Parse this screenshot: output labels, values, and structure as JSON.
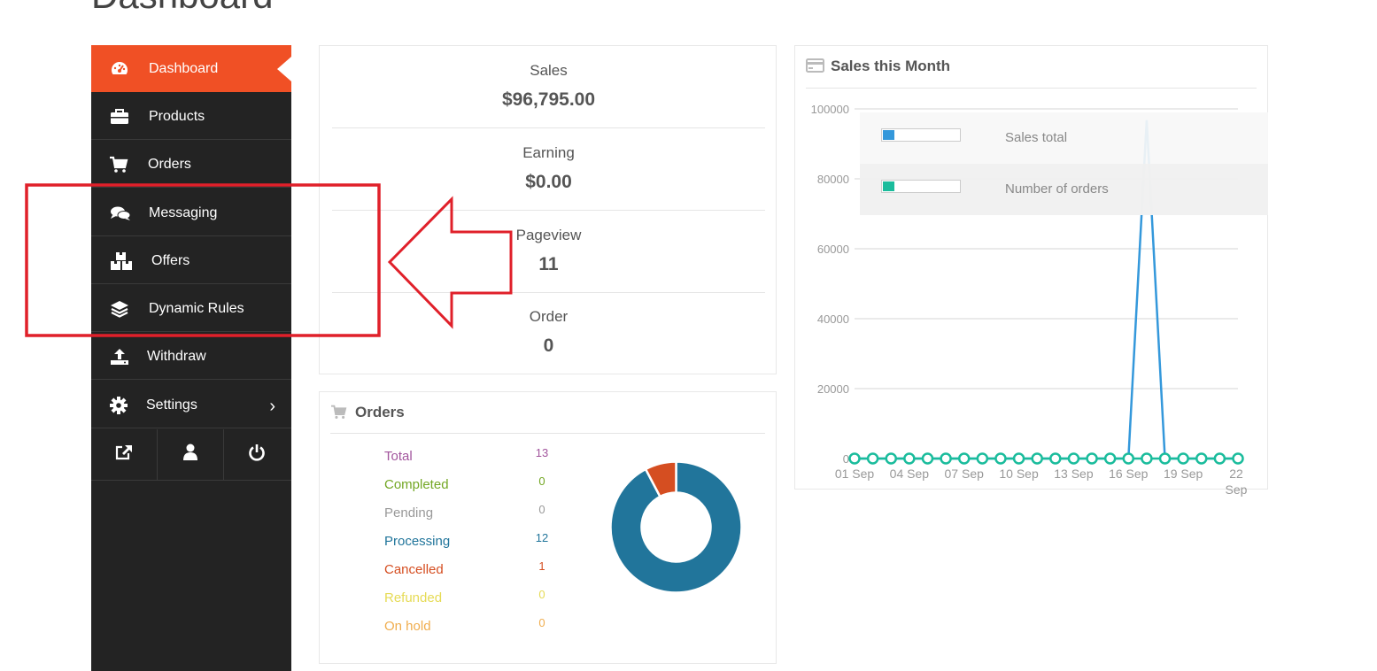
{
  "page": {
    "title": "Dashboard"
  },
  "sidebar": {
    "items": [
      {
        "label": "Dashboard",
        "icon": "dashboard-gauge-icon",
        "active": true
      },
      {
        "label": "Products",
        "icon": "briefcase-icon"
      },
      {
        "label": "Orders",
        "icon": "cart-icon"
      },
      {
        "label": "Messaging",
        "icon": "chat-bubbles-icon"
      },
      {
        "label": "Offers",
        "icon": "boxes-icon"
      },
      {
        "label": "Dynamic Rules",
        "icon": "layers-icon"
      },
      {
        "label": "Withdraw",
        "icon": "upload-icon"
      },
      {
        "label": "Settings",
        "icon": "gear-icon"
      }
    ],
    "footer": [
      "external-link-icon",
      "user-icon",
      "power-icon"
    ],
    "accent": "#f05025",
    "background": "#232323"
  },
  "stats": [
    {
      "label": "Sales",
      "value": "$96,795.00"
    },
    {
      "label": "Earning",
      "value": "$0.00"
    },
    {
      "label": "Pageview",
      "value": "11"
    },
    {
      "label": "Order",
      "value": "0"
    }
  ],
  "orders_panel": {
    "title": "Orders",
    "rows": [
      {
        "label": "Total",
        "value": "13",
        "color": "#a2559d"
      },
      {
        "label": "Completed",
        "value": "0",
        "color": "#73a724"
      },
      {
        "label": "Pending",
        "value": "0",
        "color": "#999999"
      },
      {
        "label": "Processing",
        "value": "12",
        "color": "#21759b"
      },
      {
        "label": "Cancelled",
        "value": "1",
        "color": "#d54e21"
      },
      {
        "label": "Refunded",
        "value": "0",
        "color": "#e6db55"
      },
      {
        "label": "On hold",
        "value": "0",
        "color": "#f0ad4e"
      }
    ],
    "donut": [
      {
        "label": "Processing",
        "value": 12,
        "color": "#21759b"
      },
      {
        "label": "Cancelled",
        "value": 1,
        "color": "#d54e21"
      }
    ]
  },
  "sales_month": {
    "title": "Sales this Month",
    "legend": [
      {
        "label": "Sales total",
        "color": "#3498db"
      },
      {
        "label": "Number of orders",
        "color": "#1abc9c"
      }
    ]
  },
  "chart_data": {
    "type": "line",
    "title": "Sales this Month",
    "ylim": [
      0,
      100000
    ],
    "yticks": [
      0,
      20000,
      40000,
      60000,
      80000,
      100000
    ],
    "xtick_labels": [
      "01 Sep",
      "04 Sep",
      "07 Sep",
      "10 Sep",
      "13 Sep",
      "16 Sep",
      "19 Sep",
      "22 Sep"
    ],
    "x": [
      "01 Sep",
      "02 Sep",
      "03 Sep",
      "04 Sep",
      "05 Sep",
      "06 Sep",
      "07 Sep",
      "08 Sep",
      "09 Sep",
      "10 Sep",
      "11 Sep",
      "12 Sep",
      "13 Sep",
      "14 Sep",
      "15 Sep",
      "16 Sep",
      "17 Sep",
      "18 Sep",
      "19 Sep",
      "20 Sep",
      "21 Sep",
      "22 Sep"
    ],
    "series": [
      {
        "name": "Sales total",
        "color": "#3498db",
        "values": [
          0,
          0,
          0,
          0,
          0,
          0,
          0,
          0,
          0,
          0,
          0,
          0,
          0,
          0,
          0,
          0,
          96795,
          0,
          0,
          0,
          0,
          0
        ]
      },
      {
        "name": "Number of orders",
        "color": "#1abc9c",
        "values": [
          0,
          0,
          0,
          0,
          0,
          0,
          0,
          0,
          0,
          0,
          0,
          0,
          0,
          0,
          0,
          0,
          0,
          0,
          0,
          0,
          0,
          0
        ]
      }
    ],
    "grid": true,
    "legend_position": "top-right"
  },
  "annotation": {
    "color": "#e0202a"
  }
}
